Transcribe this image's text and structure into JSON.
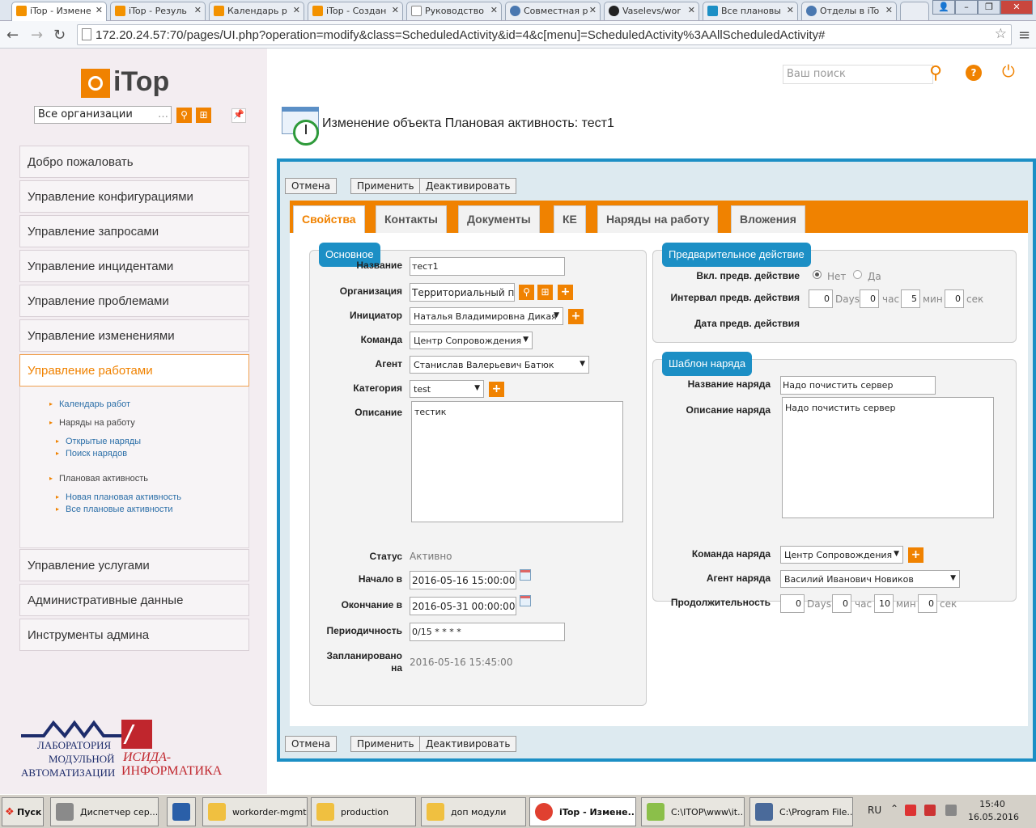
{
  "browser": {
    "tabs": [
      "iTop - Измене",
      "iTop - Резуль",
      "Календарь р",
      "iTop - Создан",
      "Руководство",
      "Совместная р",
      "Vaselevs/wor",
      "Все плановы",
      "Отделы в iTo"
    ],
    "url": "172.20.24.57:70/pages/UI.php?operation=modify&class=ScheduledActivity&id=4&c[menu]=ScheduledActivity%3AAllScheduledActivity#"
  },
  "header": {
    "logo_text": "iTop",
    "search_placeholder": "Ваш поиск",
    "org_select": "Все организации"
  },
  "left_menu": {
    "items": [
      "Добро пожаловать",
      "Управление конфигурациями",
      "Управление запросами",
      "Управление инцидентами",
      "Управление проблемами",
      "Управление изменениями",
      "Управление работами"
    ],
    "items_after": [
      "Управление услугами",
      "Административные данные",
      "Инструменты админа"
    ],
    "sub": {
      "calendar": "Календарь работ",
      "workorders": "Наряды на работу",
      "open_workorders": "Открытые наряды",
      "search_workorders": "Поиск нарядов",
      "scheduled": "Плановая активность",
      "new_scheduled": "Новая плановая активность",
      "all_scheduled": "Все плановые активности"
    },
    "footer_logo": {
      "line1": "ЛАБОРАТОРИЯ",
      "line2": "МОДУЛЬНОЙ",
      "line3": "АВТОМАТИЗАЦИИ",
      "brand1": "ИСИДА-",
      "brand2": "ИНФОРМАТИКА"
    }
  },
  "page_title": "Изменение объекта Плановая активность: тест1",
  "buttons": {
    "cancel": "Отмена",
    "apply": "Применить",
    "deactivate": "Деактивировать"
  },
  "tabs": [
    "Свойства",
    "Контакты",
    "Документы",
    "КЕ",
    "Наряды на работу",
    "Вложения"
  ],
  "main_fields": {
    "legend": "Основное",
    "name_label": "Название",
    "name": "тест1",
    "org_label": "Организация",
    "org": "Территориальный пункт",
    "initiator_label": "Инициатор",
    "initiator": "Наталья Владимировна Дикая",
    "team_label": "Команда",
    "team": "Центр Сопровождения",
    "agent_label": "Агент",
    "agent": "Станислав Валерьевич Батюк",
    "category_label": "Категория",
    "category": "test",
    "description_label": "Описание",
    "description": "тестик",
    "status_label": "Статус",
    "status": "Активно",
    "start_label": "Начало в",
    "start": "2016-05-16 15:00:00",
    "end_label": "Окончание в",
    "end": "2016-05-31 00:00:00",
    "period_label": "Периодичность",
    "period": "0/15 * * * *",
    "planned_label1": "Запланировано",
    "planned_label2": "на",
    "planned": "2016-05-16 15:45:00"
  },
  "pre_action": {
    "legend": "Предварительное действие",
    "enable_label": "Вкл. предв. действие",
    "opt_no": "Нет",
    "opt_yes": "Да",
    "selected": "Нет",
    "interval_label": "Интервал предв. действия",
    "days": "0",
    "hours": "0",
    "mins": "5",
    "secs": "0",
    "date_label": "Дата предв. действия"
  },
  "units": {
    "days": "Days",
    "hours": "час",
    "mins": "мин",
    "secs": "сек"
  },
  "template": {
    "legend": "Шаблон наряда",
    "name_label": "Название наряда",
    "name": "Надо почистить сервер",
    "desc_label": "Описание наряда",
    "desc": "Надо почистить сервер",
    "team_label": "Команда наряда",
    "team": "Центр Сопровождения",
    "agent_label": "Агент наряда",
    "agent": "Василий Иванович Новиков",
    "duration_label": "Продолжительность",
    "days": "0",
    "hours": "0",
    "mins": "10",
    "secs": "0"
  },
  "taskbar": {
    "start": "Пуск",
    "items": [
      "Диспетчер сер...",
      "workorder-mgmt",
      "production",
      "доп модули",
      "iTop - Измене...",
      "C:\\ITOP\\www\\it...",
      "C:\\Program File..."
    ],
    "lang": "RU",
    "time": "15:40",
    "date": "16.05.2016"
  }
}
